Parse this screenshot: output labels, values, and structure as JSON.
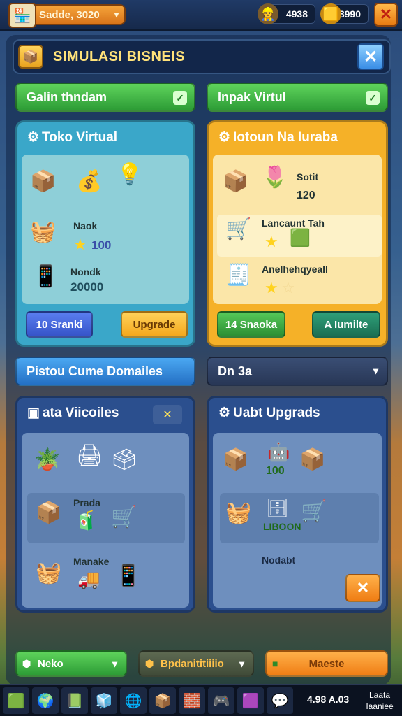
{
  "topbar": {
    "player_name": "Sadde, 3020",
    "stat1_value": "4938",
    "stat2_value": "8990"
  },
  "window": {
    "title": "SIMULASI BISNEIS"
  },
  "tabs": {
    "tab1_label": "Galin thndam",
    "tab2_label": "Inpak Virtul"
  },
  "panel_toko": {
    "title": "Toko Virtual",
    "row2_label": "Naok",
    "row2_value": "100",
    "row3_label": "Nondk",
    "row3_value": "20000",
    "button_left": "10 Sranki",
    "button_right": "Upgrade"
  },
  "panel_upgrade": {
    "title": "Iotoun Na Iuraba",
    "row1_label": "Sotit",
    "row1_value": "120",
    "row2_label": "Lancaunt Tah",
    "row3_label": "Anelhehqyeall",
    "button_left": "14 Snaoka",
    "button_right": "A Iumilte"
  },
  "section_tabs": {
    "left_label": "Pistou Cume Domailes",
    "right_label": "Dn 3a"
  },
  "panel_vitcoiles": {
    "title": "ata Viicoiles",
    "row2_label": "Prada",
    "row3_label": "Manake"
  },
  "panel_upgrads": {
    "title": "Uabt Upgrads",
    "row1_value": "100",
    "row2_value": "LIBOON",
    "row3_label": "Nodabt"
  },
  "bottom_bar": {
    "left_label": "Neko",
    "middle_label": "Bpdanititiiiio",
    "right_label": "Maeste"
  },
  "taskbar": {
    "time": "4.98 A.03",
    "side_line1": "Laata",
    "side_line2": "Iaaniee"
  }
}
